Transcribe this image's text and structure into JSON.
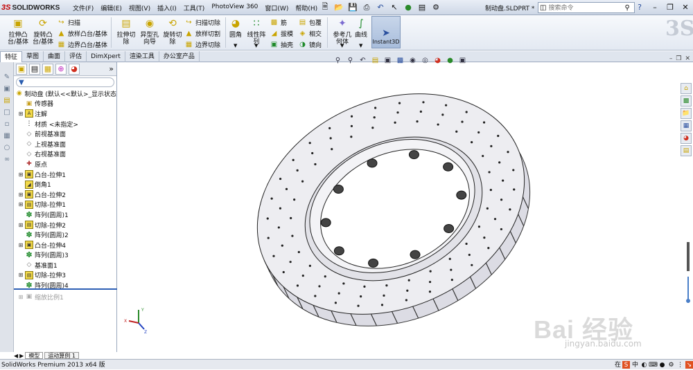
{
  "app": {
    "logo_prefix": "3S",
    "logo_name": "SOLIDWORKS",
    "file_name": "制动盘.SLDPRT *",
    "status_text": "SolidWorks Premium 2013 x64 版"
  },
  "menu": [
    "文件(F)",
    "编辑(E)",
    "视图(V)",
    "插入(I)",
    "工具(T)",
    "PhotoView 360",
    "窗口(W)",
    "帮助(H)"
  ],
  "search": {
    "placeholder": "搜索命令"
  },
  "ribbon": {
    "extrude_boss": "拉伸凸\n台/基体",
    "revolve_boss": "旋转凸\n台/基体",
    "sweep": "扫描",
    "loft_boss": "放样凸台/基体",
    "boundary_boss": "边界凸台/基体",
    "extrude_cut": "拉伸切\n除",
    "hole_wizard": "异型孔\n向导",
    "revolve_cut": "旋转切\n除",
    "swept_cut": "扫描切除",
    "lofted_cut": "放样切割",
    "boundary_cut": "边界切除",
    "fillet": "圆角",
    "linear_pattern": "线性阵\n列",
    "rib": "筋",
    "draft": "拔模",
    "shell": "抽壳",
    "wrap": "包覆",
    "intersect": "相交",
    "mirror": "镜向",
    "ref_geometry": "参考几\n何体",
    "curves": "曲线",
    "instant3d": "Instant3D"
  },
  "tabs": [
    "特征",
    "草图",
    "曲面",
    "评估",
    "DimXpert",
    "渲染工具",
    "办公室产品"
  ],
  "tree": {
    "root": "制动盘 (默认<<默认>_显示状态",
    "items": [
      {
        "label": "传感器",
        "icon": "sensor-icon",
        "expandable": false
      },
      {
        "label": "注解",
        "icon": "annotation-icon",
        "expandable": true
      },
      {
        "label": "材质 <未指定>",
        "icon": "material-icon",
        "expandable": false
      },
      {
        "label": "前视基准面",
        "icon": "plane-icon",
        "expandable": false
      },
      {
        "label": "上视基准面",
        "icon": "plane-icon",
        "expandable": false
      },
      {
        "label": "右视基准面",
        "icon": "plane-icon",
        "expandable": false
      },
      {
        "label": "原点",
        "icon": "origin-icon",
        "expandable": false
      },
      {
        "label": "凸台-拉伸1",
        "icon": "extrude-icon",
        "expandable": true
      },
      {
        "label": "倒角1",
        "icon": "chamfer-icon",
        "expandable": false
      },
      {
        "label": "凸台-拉伸2",
        "icon": "extrude-icon",
        "expandable": true
      },
      {
        "label": "切除-拉伸1",
        "icon": "cut-icon",
        "expandable": true
      },
      {
        "label": "阵列(圆周)1",
        "icon": "pattern-icon",
        "expandable": false
      },
      {
        "label": "切除-拉伸2",
        "icon": "cut-icon",
        "expandable": true
      },
      {
        "label": "阵列(圆周)2",
        "icon": "pattern-icon",
        "expandable": false
      },
      {
        "label": "凸台-拉伸4",
        "icon": "extrude-icon",
        "expandable": true
      },
      {
        "label": "阵列(圆周)3",
        "icon": "pattern-icon",
        "expandable": false
      },
      {
        "label": "基准面1",
        "icon": "plane-icon",
        "expandable": false
      },
      {
        "label": "切除-拉伸3",
        "icon": "cut-icon",
        "expandable": true
      },
      {
        "label": "阵列(圆周)4",
        "icon": "pattern-icon",
        "expandable": false
      }
    ],
    "suppressed": "缩放比例1"
  },
  "bottom_tabs": [
    "模型",
    "运动算例 1"
  ],
  "watermark": {
    "text": "Bai 经验",
    "url": "jingyan.baidu.com"
  },
  "colors": {
    "accent": "#2d5fb5",
    "feature_yellow": "#f2d94a",
    "disc": "#e9e9ee"
  }
}
